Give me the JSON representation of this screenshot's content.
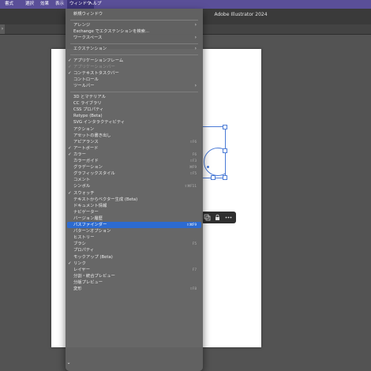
{
  "menubar": {
    "items": [
      "書式",
      "選択",
      "効果",
      "表示",
      "ウィンドウ",
      "ヘルプ"
    ],
    "active_index": 4
  },
  "titlebar": {
    "title": "Adobe Illustrator 2024"
  },
  "tabbar": {
    "left_tab_label": "›"
  },
  "context_toolbar": {
    "icons": [
      "copy-icon",
      "lock-icon",
      "more-icon"
    ]
  },
  "menu": {
    "items": [
      {
        "label": "新規ウィンドウ"
      },
      {
        "separator": true
      },
      {
        "label": "アレンジ",
        "submenu": true
      },
      {
        "label": "Exchange でエクステンションを検索..."
      },
      {
        "label": "ワークスペース",
        "submenu": true
      },
      {
        "separator": true
      },
      {
        "label": "エクステンション",
        "submenu": true
      },
      {
        "separator": true
      },
      {
        "label": "アプリケーションフレーム",
        "checked": true
      },
      {
        "label": "アプリケーションバー",
        "checked": true,
        "disabled": true
      },
      {
        "label": "コンテキストタスクバー",
        "checked": true
      },
      {
        "label": "コントロール"
      },
      {
        "label": "ツールバー",
        "submenu": true
      },
      {
        "separator": true
      },
      {
        "label": "3D とマテリアル"
      },
      {
        "label": "CC ライブラリ"
      },
      {
        "label": "CSS プロパティ"
      },
      {
        "label": "Retype (Beta)"
      },
      {
        "label": "SVG インタラクティビティ"
      },
      {
        "label": "アクション"
      },
      {
        "label": "アセットの書き出し"
      },
      {
        "label": "アピアランス",
        "shortcut": "⇧F6"
      },
      {
        "label": "アートボード",
        "checked": true
      },
      {
        "label": "カラー",
        "checked": true,
        "shortcut": "F6"
      },
      {
        "label": "カラーガイド",
        "shortcut": "⇧F3"
      },
      {
        "label": "グラデーション",
        "shortcut": "⌘F9"
      },
      {
        "label": "グラフィックスタイル",
        "shortcut": "⇧F5"
      },
      {
        "label": "コメント"
      },
      {
        "label": "シンボル",
        "shortcut": "⇧⌘F11"
      },
      {
        "label": "スウォッチ",
        "checked": true
      },
      {
        "label": "テキストからベクター生成 (Beta)"
      },
      {
        "label": "ドキュメント情報"
      },
      {
        "label": "ナビゲーター"
      },
      {
        "label": "バージョン履歴"
      },
      {
        "label": "パスファインダー",
        "shortcut": "⇧⌘F9",
        "highlighted": true
      },
      {
        "label": "パターンオプション"
      },
      {
        "label": "ヒストリー"
      },
      {
        "label": "ブラシ",
        "shortcut": "F5"
      },
      {
        "label": "プロパティ"
      },
      {
        "label": "モックアップ (Beta)"
      },
      {
        "label": "リンク",
        "checked": true
      },
      {
        "label": "レイヤー",
        "shortcut": "F7"
      },
      {
        "label": "分割・統合プレビュー"
      },
      {
        "label": "分版プレビュー"
      },
      {
        "label": "変形",
        "shortcut": "⇧F8"
      }
    ],
    "scroll_indicator": "⌄"
  },
  "colors": {
    "menubar_bg": "#5a4f98",
    "canvas_bg": "#535353",
    "highlight": "#2d6bd0",
    "selection": "#4b7bd6"
  }
}
